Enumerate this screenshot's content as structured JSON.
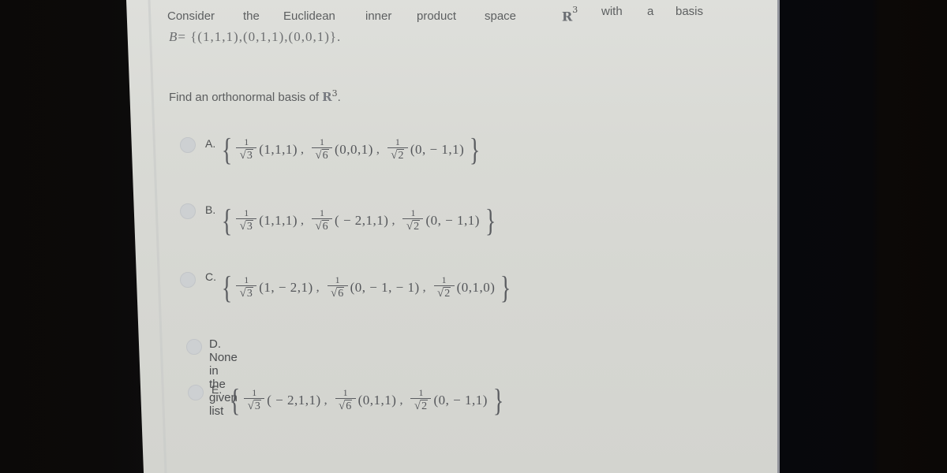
{
  "question": {
    "intro_words": [
      "Consider",
      "the",
      "Euclidean",
      "inner",
      "product",
      "space"
    ],
    "space_symbol": "R",
    "space_exponent": "3",
    "intro_tail_words": [
      "with",
      "a",
      "basis"
    ],
    "basis_var": "B",
    "basis_set": "= {(1,1,1),(0,1,1),(0,0,1)}.",
    "prompt": "Find an orthonormal basis of",
    "prompt_symbol": "R",
    "prompt_exponent": "3",
    "prompt_end": "."
  },
  "options": [
    {
      "letter": "A.",
      "terms": [
        {
          "num": "1",
          "den": "3",
          "vector": "(1,1,1)"
        },
        {
          "num": "1",
          "den": "6",
          "vector": "(0,0,1)"
        },
        {
          "num": "1",
          "den": "2",
          "vector": "(0, − 1,1)"
        }
      ]
    },
    {
      "letter": "B.",
      "terms": [
        {
          "num": "1",
          "den": "3",
          "vector": "(1,1,1)"
        },
        {
          "num": "1",
          "den": "6",
          "vector": "( − 2,1,1)"
        },
        {
          "num": "1",
          "den": "2",
          "vector": "(0, − 1,1)"
        }
      ]
    },
    {
      "letter": "C.",
      "terms": [
        {
          "num": "1",
          "den": "3",
          "vector": "(1, − 2,1)"
        },
        {
          "num": "1",
          "den": "6",
          "vector": "(0, − 1, − 1)"
        },
        {
          "num": "1",
          "den": "2",
          "vector": "(0,1,0)"
        }
      ]
    },
    {
      "letter": "D.",
      "text": "None in the given list"
    },
    {
      "letter": "E.",
      "terms": [
        {
          "num": "1",
          "den": "3",
          "vector": "( − 2,1,1)"
        },
        {
          "num": "1",
          "den": "6",
          "vector": "(0,1,1)"
        },
        {
          "num": "1",
          "den": "2",
          "vector": "(0, − 1,1)"
        }
      ]
    }
  ],
  "symbols": {
    "open_brace": "{",
    "close_brace": "}",
    "sqrt": "√",
    "comma": ","
  }
}
